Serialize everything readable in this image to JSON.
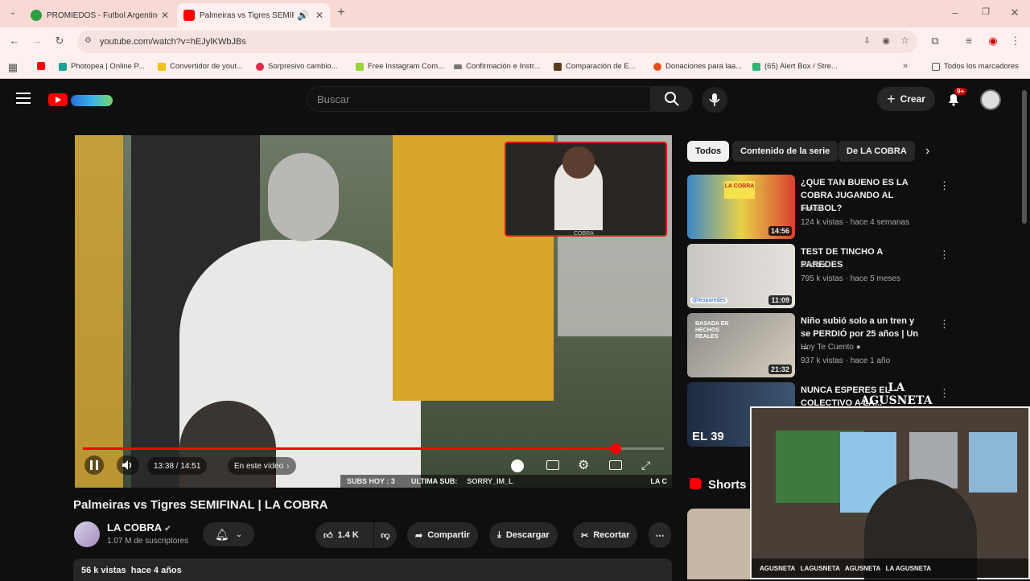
{
  "browser": {
    "tabs": [
      {
        "title": "PROMIEDOS - Futbol Argentino",
        "active": false
      },
      {
        "title": "Palmeiras vs Tigres SEMIFIN",
        "active": true
      }
    ],
    "url": "youtube.com/watch?v=hEJylKWbJBs",
    "bookmarks": [
      "Photopea | Online P...",
      "Convertidor de yout...",
      "Sorpresivo cambio...",
      "Free Instagram Com...",
      "Confirmación e Instr...",
      "Comparación de E...",
      "Donaciones para laa...",
      "(65) Alert Box / Stre..."
    ],
    "all_bookmarks": "Todos los marcadores"
  },
  "youtube": {
    "search_placeholder": "Buscar",
    "create_label": "Crear",
    "notif_badge": "9+",
    "player": {
      "time": "13:38 / 14:51",
      "chapter": "En este vídeo",
      "progress": 0.917,
      "overlay_sub_text": "SUBS HOY : 3",
      "overlay_ultima": "ULTIMA SUB:",
      "overlay_name": "SORRY_IM_L",
      "overlay_la": "LA C"
    },
    "video": {
      "title": "Palmeiras vs Tigres SEMIFINAL | LA COBRA",
      "channel": "LA COBRA",
      "subscribers": "1.07 M de suscriptores",
      "likes": "1.4 K",
      "share": "Compartir",
      "download": "Descargar",
      "clip": "Recortar",
      "views": "56 k vistas",
      "age": "hace 4 años"
    },
    "chips": [
      "Todos",
      "Contenido de la serie",
      "De LA COBRA"
    ],
    "recommendations": [
      {
        "title": "¿QUE TAN BUENO ES LA COBRA JUGANDO AL FUTBOL?",
        "channel": "Tonali",
        "meta": "124 k vistas · hace 4 semanas",
        "duration": "14:56"
      },
      {
        "title": "TEST DE TINCHO A PAREDES",
        "channel": "c0ker",
        "meta": "795 k vistas · hace 5 meses",
        "duration": "11:09"
      },
      {
        "title": "Niño subió solo a un tren y se PERDIÓ por 25 años | Un ...",
        "channel": "Hoy Te Cuento",
        "meta": "937 k vistas · hace 1 año",
        "duration": "21:32"
      },
      {
        "title": "NUNCA ESPERES EL COLECTIVO A LA...",
        "channel": "",
        "meta": "",
        "duration": ""
      }
    ],
    "shorts_label": "Shorts",
    "thumb_texts": {
      "t1": "LA COBRA",
      "t2": "@leoparedes",
      "t3": "BASADA EN HECHOS REALES",
      "t4": "EL 39"
    }
  },
  "stream_overlay": {
    "streamer_tag": "LA AGUSNETA",
    "socials": "AGUSNETA   LAGUSNETA   AGUSNETA   LA AGUSNETA",
    "cam_tag": "COBRA"
  },
  "colors": {
    "accent": "#ff0000",
    "bg": "#0f0f0f"
  }
}
